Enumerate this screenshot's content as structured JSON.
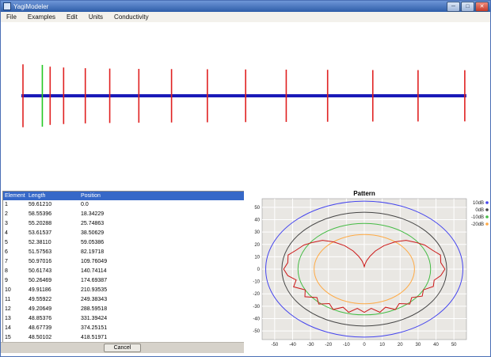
{
  "window": {
    "title": "YagiModeler"
  },
  "menu": {
    "items": [
      "File",
      "Examples",
      "Edit",
      "Units",
      "Conductivity"
    ]
  },
  "antenna": {
    "boom_color": "#1a1ab8",
    "element_color": "#e02020",
    "driven_color": "#22c922",
    "driven_index": 1
  },
  "table": {
    "headers": [
      "Element",
      "Length",
      "Position"
    ],
    "rows": [
      [
        "1",
        "59.61210",
        "0.0"
      ],
      [
        "2",
        "58.55396",
        "18.34229"
      ],
      [
        "3",
        "55.20288",
        "25.74863"
      ],
      [
        "4",
        "53.61537",
        "38.50629"
      ],
      [
        "5",
        "52.38110",
        "59.05386"
      ],
      [
        "6",
        "51.57563",
        "82.19718"
      ],
      [
        "7",
        "50.97016",
        "109.76049"
      ],
      [
        "8",
        "50.61743",
        "140.74114"
      ],
      [
        "9",
        "50.26469",
        "174.69387"
      ],
      [
        "10",
        "49.91186",
        "210.93535"
      ],
      [
        "11",
        "49.55922",
        "249.38343"
      ],
      [
        "12",
        "49.20649",
        "288.59518"
      ],
      [
        "13",
        "48.85376",
        "331.39424"
      ],
      [
        "14",
        "48.67739",
        "374.25151"
      ],
      [
        "15",
        "48.50102",
        "418.51971"
      ]
    ]
  },
  "cancel_label": "Cancel",
  "chart_data": {
    "type": "line",
    "subtype": "polar-radiation-pattern",
    "title": "Pattern",
    "xlabel": "",
    "ylabel": "",
    "xticks": [
      -50,
      -40,
      -30,
      -20,
      -10,
      0,
      10,
      20,
      30,
      40,
      50
    ],
    "yticks": [
      50,
      40,
      30,
      20,
      10,
      0,
      -10,
      -20,
      -30,
      -40,
      -50
    ],
    "xlim": [
      -57,
      57
    ],
    "ylim": [
      -57,
      57
    ],
    "grid": true,
    "legend_position": "right",
    "rings": [
      {
        "label": "10dB",
        "color": "#4444ee",
        "radius": 55
      },
      {
        "label": "0dB",
        "color": "#444444",
        "radius": 46
      },
      {
        "label": "-10dB",
        "color": "#44bb44",
        "radius": 37
      },
      {
        "label": "-20dB",
        "color": "#ffaa44",
        "radius": 28
      }
    ],
    "pattern": {
      "color": "#cc1818",
      "points_polar": [
        [
          0,
          45
        ],
        [
          7,
          43
        ],
        [
          15,
          44
        ],
        [
          22,
          41
        ],
        [
          30,
          39
        ],
        [
          37,
          36
        ],
        [
          45,
          33
        ],
        [
          52,
          28
        ],
        [
          60,
          22
        ],
        [
          67,
          16
        ],
        [
          73,
          11
        ],
        [
          79,
          7
        ],
        [
          84,
          4
        ],
        [
          90,
          2
        ],
        [
          96,
          4
        ],
        [
          101,
          7
        ],
        [
          107,
          11
        ],
        [
          113,
          16
        ],
        [
          120,
          22
        ],
        [
          128,
          28
        ],
        [
          135,
          33
        ],
        [
          143,
          36
        ],
        [
          150,
          39
        ],
        [
          158,
          41
        ],
        [
          165,
          44
        ],
        [
          173,
          43
        ],
        [
          180,
          45
        ],
        [
          187,
          43
        ],
        [
          193,
          39
        ],
        [
          200,
          42
        ],
        [
          207,
          37
        ],
        [
          214,
          40
        ],
        [
          221,
          35
        ],
        [
          228,
          38
        ],
        [
          235,
          34
        ],
        [
          242,
          37
        ],
        [
          249,
          33
        ],
        [
          256,
          36
        ],
        [
          263,
          32
        ],
        [
          270,
          35
        ],
        [
          277,
          32
        ],
        [
          284,
          36
        ],
        [
          291,
          33
        ],
        [
          298,
          37
        ],
        [
          305,
          34
        ],
        [
          312,
          38
        ],
        [
          319,
          35
        ],
        [
          326,
          39
        ],
        [
          333,
          37
        ],
        [
          340,
          41
        ],
        [
          347,
          40
        ],
        [
          353,
          43
        ]
      ]
    }
  }
}
